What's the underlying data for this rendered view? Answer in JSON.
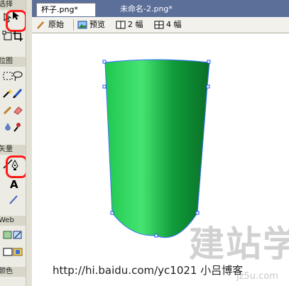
{
  "toolbox": {
    "sections": {
      "select": "选择",
      "bitmap": "位图",
      "vector": "矢量",
      "web": "Web",
      "colors": "颜色"
    }
  },
  "tabs": [
    {
      "label": "杯子.png*"
    },
    {
      "label": "未命名-2.png*"
    }
  ],
  "viewbar": {
    "original": "原始",
    "preview": "预览",
    "two_up": "2 幅",
    "four_up": "4 幅"
  },
  "watermark": {
    "url": "http://hi.baidu.com/yc1021  小吕博客",
    "site_cn": "建站学",
    "site_en": "jz5u.com"
  },
  "colors": {
    "cup_dark": "#0a7a2c",
    "cup_light": "#3fe06a",
    "tabbar": "#5b6f99",
    "highlight": "#ff1a1a"
  }
}
